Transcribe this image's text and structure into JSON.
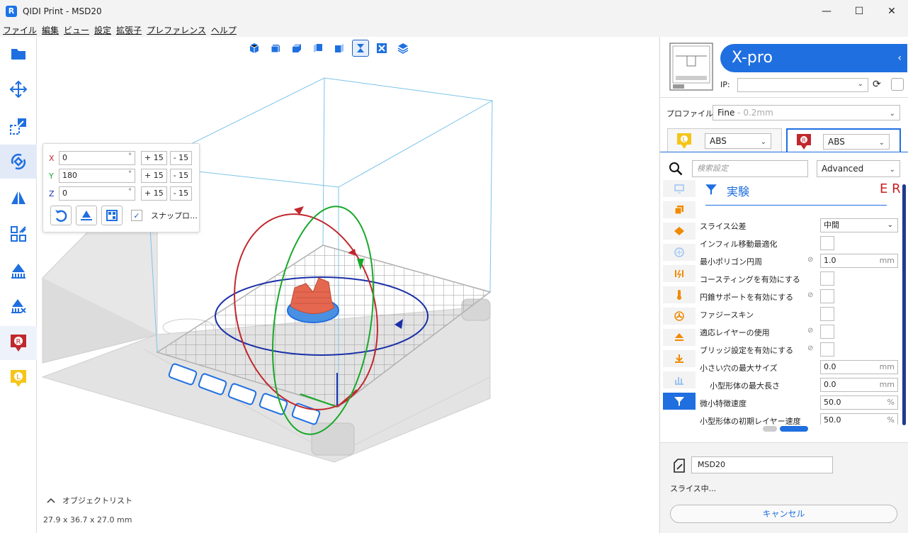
{
  "window": {
    "title": "QIDI Print - MSD20",
    "logo_letter": "R",
    "controls": {
      "minimize": "—",
      "maximize": "☐",
      "close": "✕"
    }
  },
  "menu": [
    "ファイル",
    "編集",
    "ビュー",
    "設定",
    "拡張子",
    "プレファレンス",
    "ヘルプ"
  ],
  "left_toolbar": [
    {
      "name": "open-file-tool",
      "icon": "folder-icon",
      "active": false
    },
    {
      "name": "move-tool",
      "icon": "move-arrows-icon",
      "active": false
    },
    {
      "name": "scale-tool",
      "icon": "scale-icon",
      "active": false
    },
    {
      "name": "rotate-tool",
      "icon": "rotate-icon",
      "active": true
    },
    {
      "name": "mirror-tool",
      "icon": "mirror-icon",
      "active": false
    },
    {
      "name": "arrange-tool",
      "icon": "arrange-icon",
      "active": false
    },
    {
      "name": "support-tool",
      "icon": "support-icon",
      "active": false
    },
    {
      "name": "support-eraser-tool",
      "icon": "support-eraser-icon",
      "active": false
    },
    {
      "name": "extruder-r-tool",
      "icon": "extruder-r-icon",
      "active": false,
      "letter": "R"
    },
    {
      "name": "extruder-l-tool",
      "icon": "extruder-l-icon",
      "active": false,
      "letter": "L"
    }
  ],
  "view_toolbar": [
    "view-3d-icon",
    "view-front-icon",
    "view-top-icon",
    "view-left-icon",
    "view-right-icon",
    "view-xray-icon",
    "view-layers-icon",
    "view-stack-icon"
  ],
  "rotate_panel": {
    "x": {
      "label": "X",
      "value": "0",
      "unit": "°",
      "plus": "+ 15",
      "minus": "- 15"
    },
    "y": {
      "label": "Y",
      "value": "180",
      "unit": "°",
      "plus": "+ 15",
      "minus": "- 15"
    },
    "z": {
      "label": "Z",
      "value": "0",
      "unit": "°",
      "plus": "+ 15",
      "minus": "- 15"
    },
    "snap_label": "スナップロ…",
    "snap_checked": true
  },
  "object_list_label": "オブジェクトリスト",
  "object_dimensions": "27.9 x 36.7 x 27.0 mm",
  "printer": {
    "name": "X-pro",
    "ip_label": "IP:",
    "ip_value": ""
  },
  "profile": {
    "label": "プロファイル",
    "value": "Fine",
    "detail": " - 0.2mm"
  },
  "extruders": [
    {
      "letter": "L",
      "material": "ABS",
      "active": false,
      "color": "#f5c518"
    },
    {
      "letter": "R",
      "material": "ABS",
      "active": true,
      "color": "#c0282d"
    }
  ],
  "settings_search": {
    "placeholder": "検索設定",
    "level": "Advanced"
  },
  "section": {
    "title": "実験",
    "badge": "E R"
  },
  "settings": [
    {
      "label": "スライス公差",
      "type": "select",
      "value": "中間",
      "linked": false
    },
    {
      "label": "インフィル移動最適化",
      "type": "check",
      "linked": false
    },
    {
      "label": "最小ポリゴン円周",
      "type": "number",
      "value": "1.0",
      "unit": "mm",
      "linked": true
    },
    {
      "label": "コースティングを有効にする",
      "type": "check",
      "linked": false
    },
    {
      "label": "円錐サポートを有効にする",
      "type": "check",
      "linked": true
    },
    {
      "label": "ファジースキン",
      "type": "check",
      "linked": false
    },
    {
      "label": "適応レイヤーの使用",
      "type": "check",
      "linked": true
    },
    {
      "label": "ブリッジ設定を有効にする",
      "type": "check",
      "linked": true
    },
    {
      "label": "小さい穴の最大サイズ",
      "type": "number",
      "value": "0.0",
      "unit": "mm",
      "linked": false
    },
    {
      "label": "小型形体の最大長さ",
      "type": "number",
      "value": "0.0",
      "unit": "mm",
      "linked": false,
      "indent": true
    },
    {
      "label": "微小特徴速度",
      "type": "number",
      "value": "50.0",
      "unit": "%",
      "linked": false
    },
    {
      "label": "小型形体の初期レイヤー速度",
      "type": "number",
      "value": "50.0",
      "unit": "%",
      "linked": false
    }
  ],
  "job": {
    "name": "MSD20",
    "status": "スライス中...",
    "cancel_label": "キャンセル"
  },
  "colors": {
    "accent": "#1f6fe0",
    "model": "#e5674f",
    "rotate_x": "#c0282d",
    "rotate_y": "#18a82a",
    "rotate_z": "#1b2fa8",
    "extruder_l": "#f5c518",
    "extruder_r": "#c0282d"
  }
}
